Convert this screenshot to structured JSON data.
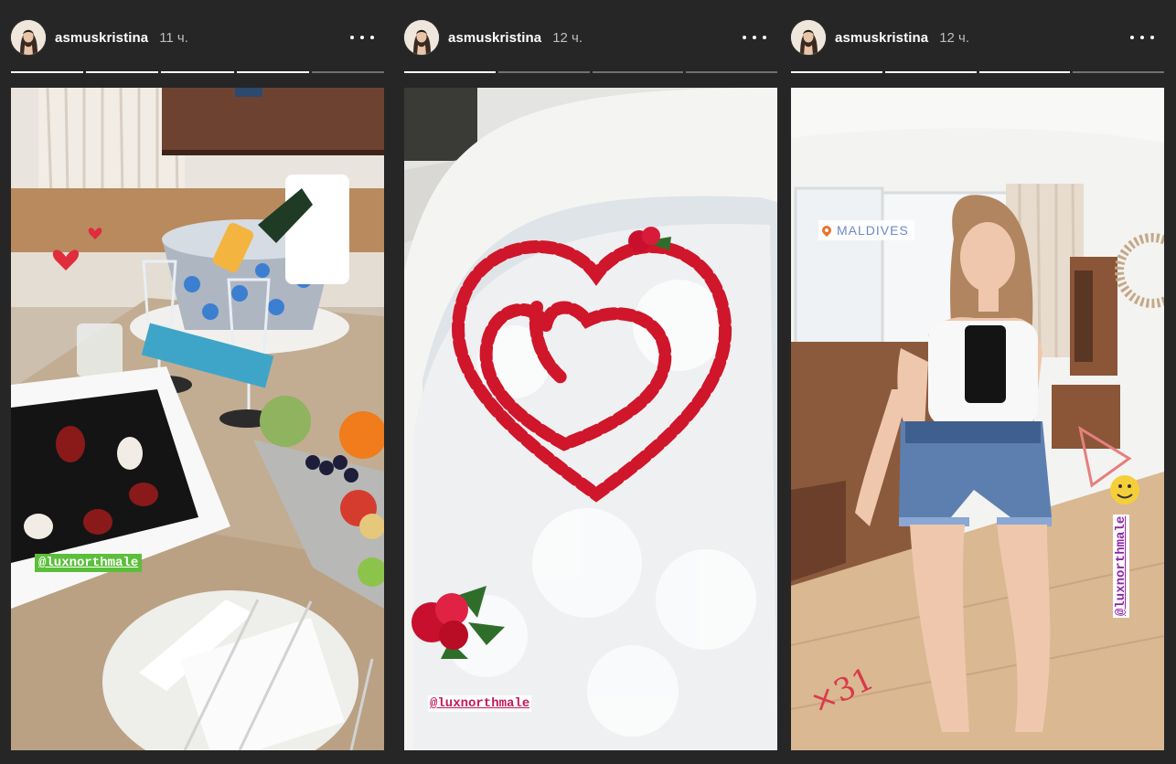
{
  "stories": [
    {
      "username": "asmuskristina",
      "time": "11 ч.",
      "progress": [
        1,
        1,
        1,
        1,
        0
      ],
      "mention": "@luxnorthmale"
    },
    {
      "username": "asmuskristina",
      "time": "12 ч.",
      "progress": [
        1,
        0,
        0,
        0
      ],
      "mention": "@luxnorthmale"
    },
    {
      "username": "asmuskristina",
      "time": "12 ч.",
      "progress": [
        1,
        1,
        1,
        0
      ],
      "mention": "@luxnorthmale",
      "location": "MALDIVES",
      "doodle": "×31"
    }
  ],
  "icons": {
    "more": "more-options-icon",
    "location": "location-pin-icon"
  },
  "colors": {
    "background": "#262626",
    "mention_green": "#5bbf3a",
    "mention_pink": "#c2185b",
    "mention_purple": "#8e24aa"
  }
}
